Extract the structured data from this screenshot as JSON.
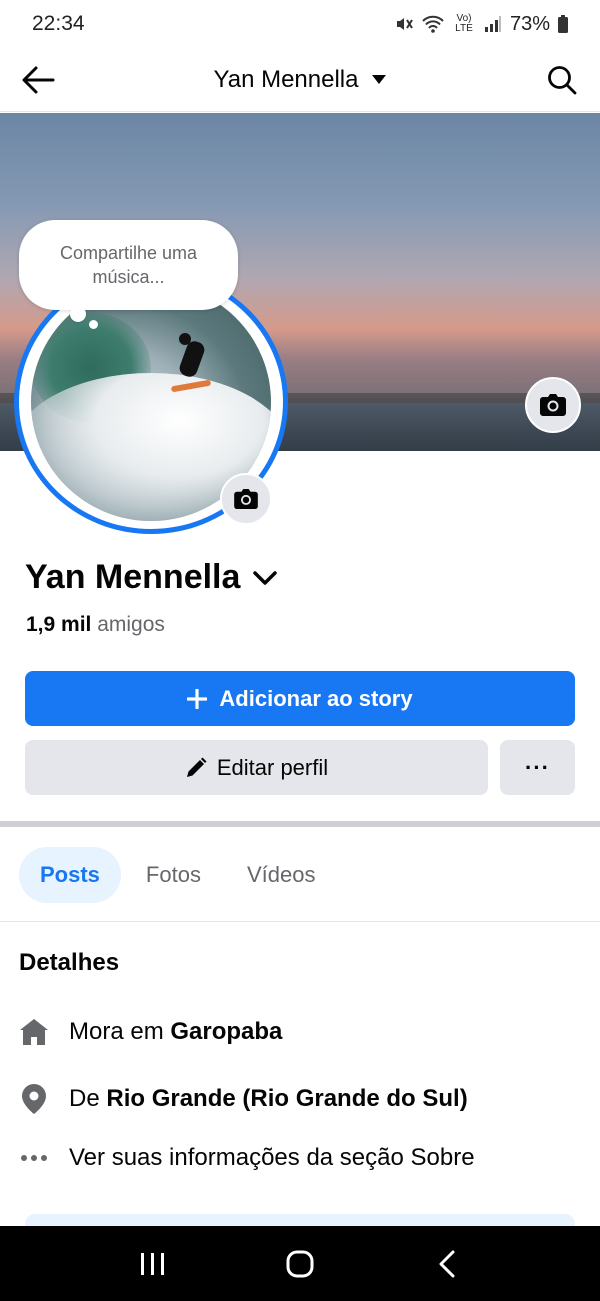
{
  "status_bar": {
    "time": "22:34",
    "battery_percent": "73%",
    "network_label": "Vo) LTE"
  },
  "header": {
    "title": "Yan Mennella",
    "back_icon": "arrow-left-icon",
    "search_icon": "search-icon"
  },
  "cover": {
    "camera_icon": "camera-icon"
  },
  "music_bubble": {
    "text": "Compartilhe uma música..."
  },
  "profile": {
    "name": "Yan Mennella",
    "friends_count": "1,9 mil",
    "friends_label": "amigos"
  },
  "actions": {
    "add_story_label": "Adicionar ao story",
    "edit_profile_label": "Editar perfil",
    "more_label": "···"
  },
  "tabs": [
    {
      "label": "Posts",
      "active": true
    },
    {
      "label": "Fotos",
      "active": false
    },
    {
      "label": "Vídeos",
      "active": false
    }
  ],
  "details": {
    "title": "Detalhes",
    "lives_prefix": "Mora em",
    "lives_place": "Garopaba",
    "from_prefix": "De",
    "from_place": "Rio Grande (Rio Grande do Sul)",
    "about_link": "Ver suas informações da seção Sobre"
  },
  "colors": {
    "accent": "#1877f2",
    "button_gray": "#e4e6eb",
    "tab_active_bg": "#e7f3ff",
    "text_secondary": "#65676b"
  }
}
